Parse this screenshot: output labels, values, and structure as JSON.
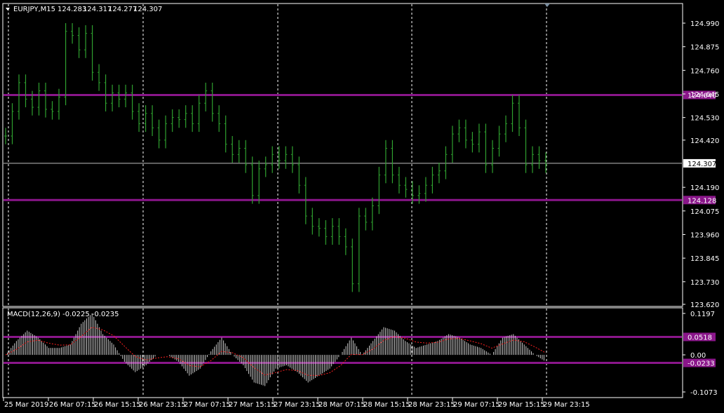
{
  "main_header": {
    "symbol": "EURJPY,M15",
    "open": "124.283",
    "high": "124.317",
    "low": "124.277",
    "close": "124.307"
  },
  "main_price_axis": [
    "124.990",
    "124.875",
    "124.760",
    "124.645",
    "124.530",
    "124.420",
    "124.307",
    "124.190",
    "124.075",
    "123.960",
    "123.845",
    "123.730",
    "123.620"
  ],
  "price_range": [
    123.62,
    125.05
  ],
  "horizontal_lines": [
    {
      "price": 124.64,
      "label": "124.640"
    },
    {
      "price": 124.128,
      "label": "124.128"
    }
  ],
  "current_price": {
    "price": 124.307,
    "label": "124.307"
  },
  "macd_header": "MACD(12,26,9) -0.0225 -0.0235",
  "macd_axis": [
    "0.1197",
    "0.00",
    "-0.1073"
  ],
  "macd_range": [
    -0.1073,
    0.1197
  ],
  "macd_levels": [
    {
      "value": 0.0518,
      "label": "0.0518"
    },
    {
      "value": -0.0233,
      "label": "-0.0233"
    }
  ],
  "time_axis": [
    "25 Mar 2019",
    "26 Mar 07:15",
    "26 Mar 15:15",
    "26 Mar 23:15",
    "27 Mar 07:15",
    "27 Mar 15:15",
    "27 Mar 23:15",
    "28 Mar 07:15",
    "28 Mar 15:15",
    "28 Mar 23:15",
    "29 Mar 07:15",
    "29 Mar 15:15",
    "29 Mar 23:15"
  ],
  "colors": {
    "background": "#000000",
    "grid": "#ffffff",
    "bars": "#2fa02f",
    "hline": "#8a168a",
    "macd_hist": "#c8c8c8",
    "macd_signal": "#ff2020",
    "price_tag": "#ffffff"
  },
  "chart_data": {
    "type": "bar",
    "series": [
      {
        "name": "EURJPY,M15",
        "values": [
          124.44,
          124.56,
          124.7,
          124.62,
          124.58,
          124.66,
          124.57,
          124.56,
          124.63,
          124.95,
          124.93,
          124.86,
          124.94,
          124.75,
          124.7,
          124.6,
          124.65,
          124.62,
          124.65,
          124.56,
          124.5,
          124.55,
          124.48,
          124.42,
          124.5,
          124.53,
          124.52,
          124.55,
          124.5,
          124.6,
          124.66,
          124.55,
          124.5,
          124.4,
          124.35,
          124.38,
          124.3,
          124.15,
          124.28,
          124.3,
          124.35,
          124.32,
          124.35,
          124.3,
          124.2,
          124.05,
          124.0,
          123.99,
          123.95,
          124.0,
          123.95,
          123.9,
          123.72,
          124.05,
          124.02,
          124.1,
          124.25,
          124.38,
          124.25,
          124.2,
          124.18,
          124.15,
          124.16,
          124.2,
          124.25,
          124.27,
          124.35,
          124.45,
          124.48,
          124.42,
          124.4,
          124.46,
          124.3,
          124.38,
          124.45,
          124.5,
          124.6,
          124.48,
          124.3,
          124.35,
          124.32,
          124.3
        ]
      },
      {
        "name": "MACD(12,26,9)",
        "values": [
          0.0,
          0.04,
          0.07,
          0.05,
          0.02,
          0.02,
          0.03,
          0.09,
          0.12,
          0.06,
          0.03,
          -0.02,
          -0.05,
          -0.03,
          0.0,
          0.0,
          -0.02,
          -0.06,
          -0.04,
          0.01,
          0.05,
          0.0,
          -0.03,
          -0.08,
          -0.09,
          -0.04,
          -0.03,
          -0.05,
          -0.08,
          -0.06,
          -0.04,
          0.0,
          0.05,
          0.0,
          0.04,
          0.08,
          0.07,
          0.04,
          0.02,
          0.03,
          0.04,
          0.06,
          0.05,
          0.03,
          0.02,
          0.0,
          0.05,
          0.06,
          0.03,
          0.0,
          -0.02
        ]
      }
    ]
  }
}
